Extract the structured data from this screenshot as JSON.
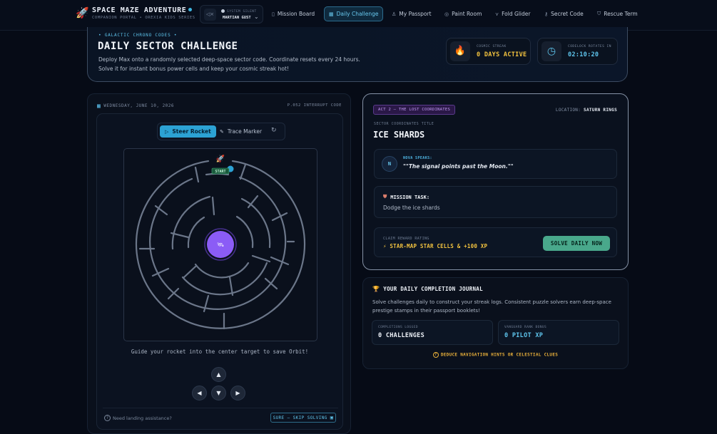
{
  "app": {
    "brand_title": "SPACE MAZE ADVENTURE",
    "brand_sub": "COMPANION PORTAL • OREXIA KIDS SERIES",
    "brand_icon": "rocket-icon"
  },
  "system": {
    "label": "SYSTEM SILENT",
    "value": "MARTIAN GUST",
    "mute_icon": "speaker-mute-icon"
  },
  "nav": {
    "items": [
      {
        "label": "Mission Board",
        "icon": "book-icon",
        "active": false
      },
      {
        "label": "Daily Challenge",
        "icon": "calendar-icon",
        "active": true
      },
      {
        "label": "My Passport",
        "icon": "user-icon",
        "active": false
      },
      {
        "label": "Paint Room",
        "icon": "palette-icon",
        "active": false
      },
      {
        "label": "Fold Glider",
        "icon": "glider-icon",
        "active": false
      },
      {
        "label": "Secret Code",
        "icon": "key-icon",
        "active": false
      },
      {
        "label": "Rescue Term",
        "icon": "shield-check-icon",
        "active": false
      }
    ]
  },
  "header": {
    "eyebrow": "• GALACTIC CHRONO CODES •",
    "title": "DAILY SECTOR CHALLENGE",
    "description": "Deploy Max onto a randomly selected deep-space sector code. Coordinate resets every 24 hours. Solve it for instant bonus power cells and keep your cosmic streak hot!",
    "streak_label": "COSMIC STREAK",
    "streak_value": "0 DAYS ACTIVE",
    "clock_label": "CODELOCK ROTATES IN",
    "clock_value": "02:10:20",
    "accent_yellow": "#f2c23f",
    "accent_cyan": "#5ec4ec"
  },
  "maze": {
    "date": "WEDNESDAY, JUNE 10, 2026",
    "code": "P.052 INTERRUPT CODE",
    "tool_steer": "Steer Rocket",
    "tool_trace": "Trace Marker",
    "start_label": "START",
    "caption": "Guide your rocket into the center target to save Orbit!",
    "help": "Need landing assistance?",
    "skip": "SURE – SKIP SOLVING"
  },
  "story": {
    "act": "ACT 2 – THE LOST COORDINATES",
    "location_label": "LOCATION:",
    "location_value": "SATURN RINGS",
    "sector_label": "SECTOR COORDINATES TITLE",
    "sector_title": "ICE SHARDS",
    "nova_avatar": "N",
    "nova_label": "NOVA SPEAKS:",
    "nova_quote": "\"\"The signal points past the Moon.\"\"",
    "task_label": "MISSION TASK:",
    "task_text": "Dodge the ice shards",
    "reward_label": "CLAIM REWARD RATING",
    "reward_value": "⚡ STAR-MAP STAR CELLS & +100 XP",
    "solve_button": "SOLVE DAILY NOW",
    "solve_color": "#49a88b"
  },
  "journal": {
    "title": "YOUR DAILY COMPLETION JOURNAL",
    "description": "Solve challenges daily to construct your streak logs. Consistent puzzle solvers earn deep-space prestige stamps in their passport booklets!",
    "completed_label": "COMPLETIONS LOGGED",
    "completed_value": "0 CHALLENGES",
    "rank_label": "VANGUARD RANK BONUS",
    "rank_value": "0 PILOT XP",
    "hint": "DEDUCE NAVIGATION HINTS OR CELESTIAL CLUES"
  }
}
